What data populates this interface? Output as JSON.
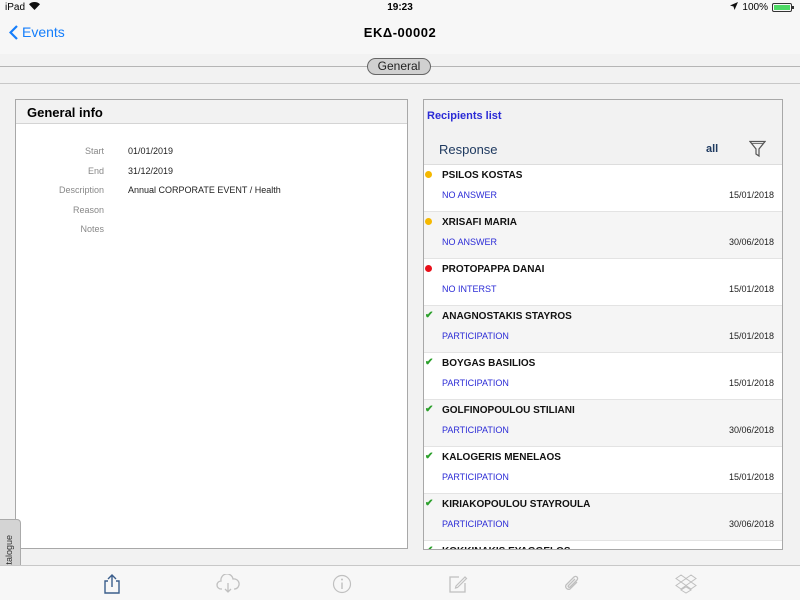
{
  "status_bar": {
    "device": "iPad",
    "time": "19:23",
    "battery": "100%",
    "battery_level": 1.0
  },
  "nav": {
    "back_label": "Events",
    "title": "ΕΚΔ-00002"
  },
  "segment": {
    "selected": "General"
  },
  "general_info": {
    "title": "General info",
    "rows": [
      {
        "label": "Start",
        "value": "01/01/2019"
      },
      {
        "label": "End",
        "value": "31/12/2019"
      },
      {
        "label": "Description",
        "value": "Annual CORPORATE EVENT / Health"
      },
      {
        "label": "Reason",
        "value": ""
      },
      {
        "label": "Notes",
        "value": ""
      }
    ]
  },
  "recipients": {
    "title": "Recipients list",
    "header_label": "Response",
    "filter_label": "all",
    "colors": {
      "no_answer": "#f5b800",
      "no_interest": "#e8101a",
      "participation": "#2ca02c"
    },
    "items": [
      {
        "name": "PSILOS KOSTAS",
        "status": "NO ANSWER",
        "date": "15/01/2018",
        "indicator": "dot-yellow"
      },
      {
        "name": "XRISAFI MARIA",
        "status": "NO ANSWER",
        "date": "30/06/2018",
        "indicator": "dot-yellow"
      },
      {
        "name": "PROTOPAPPA DANAI",
        "status": "NO INTERST",
        "date": "15/01/2018",
        "indicator": "dot-red"
      },
      {
        "name": "ANAGNOSTAKIS STAYROS",
        "status": "PARTICIPATION",
        "date": "15/01/2018",
        "indicator": "check"
      },
      {
        "name": "BOYGAS BASILIOS",
        "status": "PARTICIPATION",
        "date": "15/01/2018",
        "indicator": "check"
      },
      {
        "name": "GOLFINOPOULOU STILIANI",
        "status": "PARTICIPATION",
        "date": "30/06/2018",
        "indicator": "check"
      },
      {
        "name": "KALOGERIS MENELAOS",
        "status": "PARTICIPATION",
        "date": "15/01/2018",
        "indicator": "check"
      },
      {
        "name": "KIRIAKOPOULOU STAYROULA",
        "status": "PARTICIPATION",
        "date": "30/06/2018",
        "indicator": "check"
      },
      {
        "name": "KOKKINAKIS EYAGGELOS",
        "status": "",
        "date": "",
        "indicator": "check"
      }
    ]
  },
  "side_tab": {
    "label": "Catalogue"
  },
  "toolbar": {
    "icons": [
      "share-icon",
      "cloud-download-icon",
      "info-icon",
      "compose-icon",
      "attachment-icon",
      "dropbox-icon"
    ]
  }
}
